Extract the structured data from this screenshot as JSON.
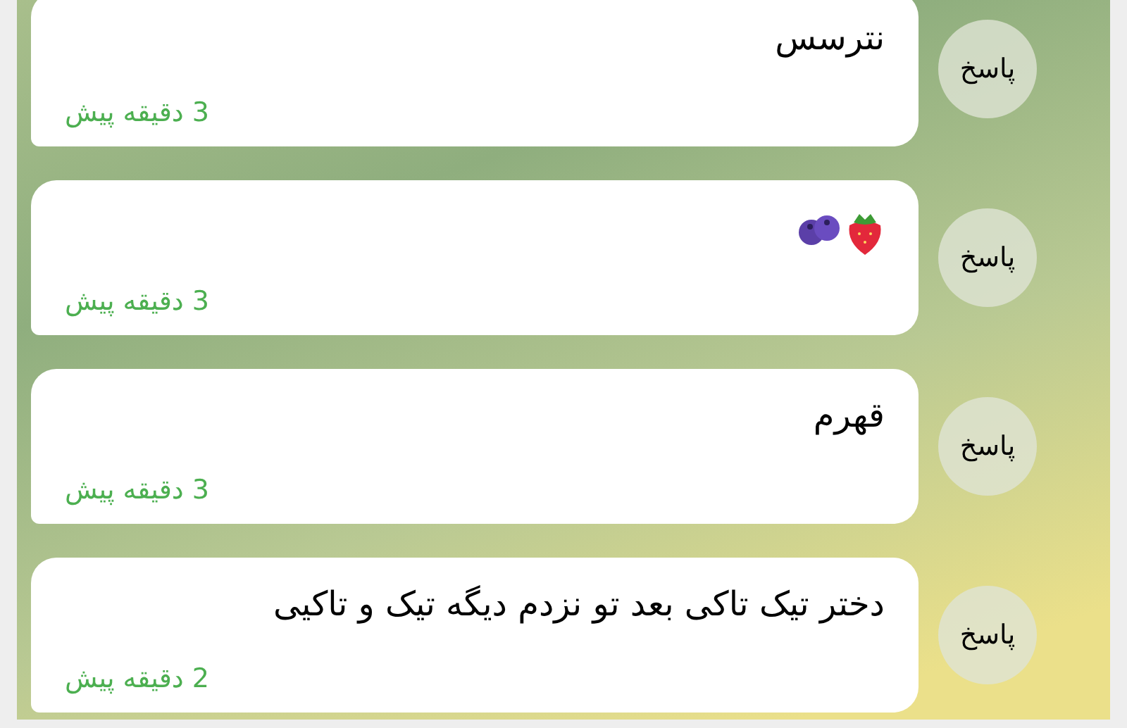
{
  "messages": [
    {
      "kind": "text",
      "text": "نترسس",
      "time": "3 دقیقه پیش",
      "reply": "پاسخ"
    },
    {
      "kind": "emoji",
      "time": "3 دقیقه پیش",
      "reply": "پاسخ"
    },
    {
      "kind": "text",
      "text": "قهرم",
      "time": "3 دقیقه پیش",
      "reply": "پاسخ"
    },
    {
      "kind": "text",
      "text": "دختر تیک تاکی بعد تو نزدم دیگه تیک و تاکیی",
      "time": "2 دقیقه پیش",
      "reply": "پاسخ"
    }
  ]
}
